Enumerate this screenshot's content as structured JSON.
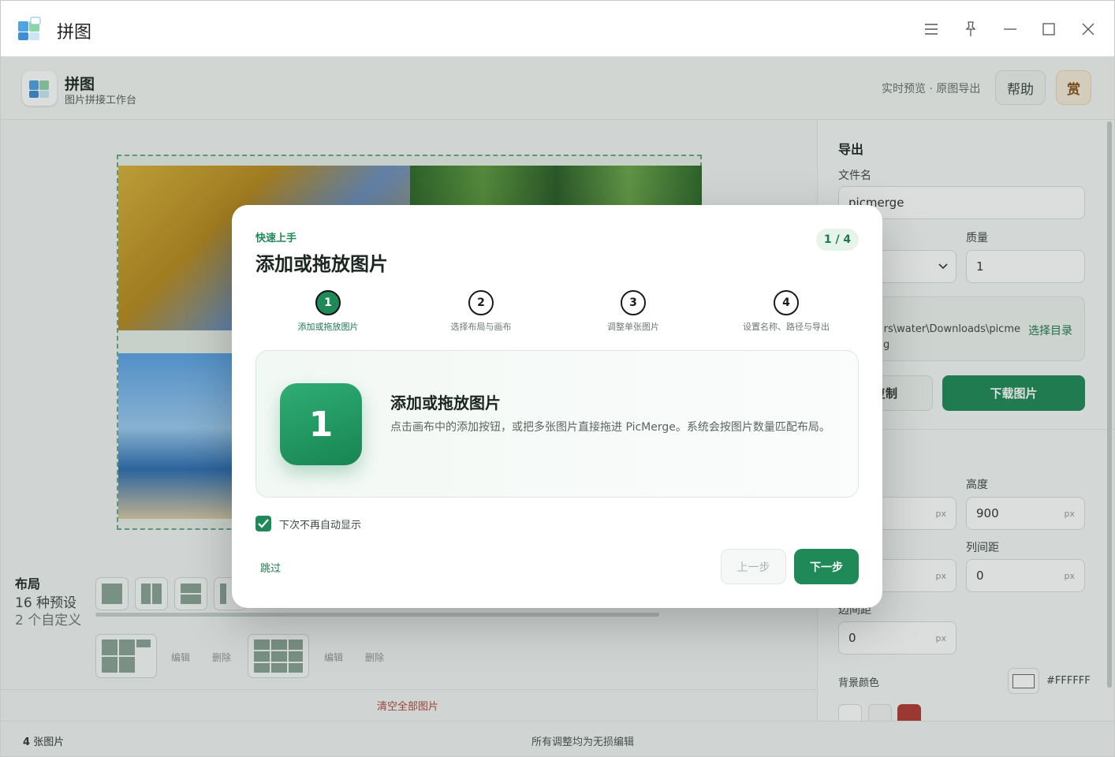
{
  "window": {
    "title": "拼图"
  },
  "header": {
    "title": "拼图",
    "subtitle": "图片拼接工作台",
    "tagline": "实时预览 · 原图导出",
    "help_label": "帮助",
    "reward_label": "赏"
  },
  "layout_panel": {
    "title": "布局",
    "presets": "16 种预设",
    "custom": "2 个自定义",
    "edit_label": "编辑",
    "delete_label": "删除",
    "clear_all": "清空全部图片"
  },
  "export": {
    "title": "导出",
    "filename_label": "文件名",
    "filename_value": "picmerge",
    "quality_label": "质量",
    "quality_value": "1",
    "path_value": "rs\\water\\Downloads\\picme",
    "path_value2": "g",
    "choose_dir": "选择目录",
    "copy_label": "复制",
    "download_label": "下载图片",
    "height_label": "高度",
    "height_value": "900",
    "col_gap_label": "列间距",
    "col_gap_value": "0",
    "margin_label": "边间距",
    "margin_value": "0",
    "width_value": "",
    "row_gap_value": "",
    "unit": "px",
    "bg_label": "背景颜色",
    "bg_value": "#FFFFFF"
  },
  "status": {
    "count_num": "4",
    "count_label": "张图片",
    "note": "所有调整均为无损编辑"
  },
  "modal": {
    "kicker": "快速上手",
    "title": "添加或拖放图片",
    "counter": "1 / 4",
    "steps": [
      {
        "num": "1",
        "label": "添加或拖放图片"
      },
      {
        "num": "2",
        "label": "选择布局与画布"
      },
      {
        "num": "3",
        "label": "调整单张图片"
      },
      {
        "num": "4",
        "label": "设置名称、路径与导出"
      }
    ],
    "card_num": "1",
    "card_title": "添加或拖放图片",
    "card_desc": "点击画布中的添加按钮，或把多张图片直接拖进 PicMerge。系统会按图片数量匹配布局。",
    "checkbox_label": "下次不再自动显示",
    "skip_label": "跳过",
    "prev_label": "上一步",
    "next_label": "下一步"
  },
  "colors": {
    "accent": "#1f8a58",
    "reward": "#b5772e"
  }
}
